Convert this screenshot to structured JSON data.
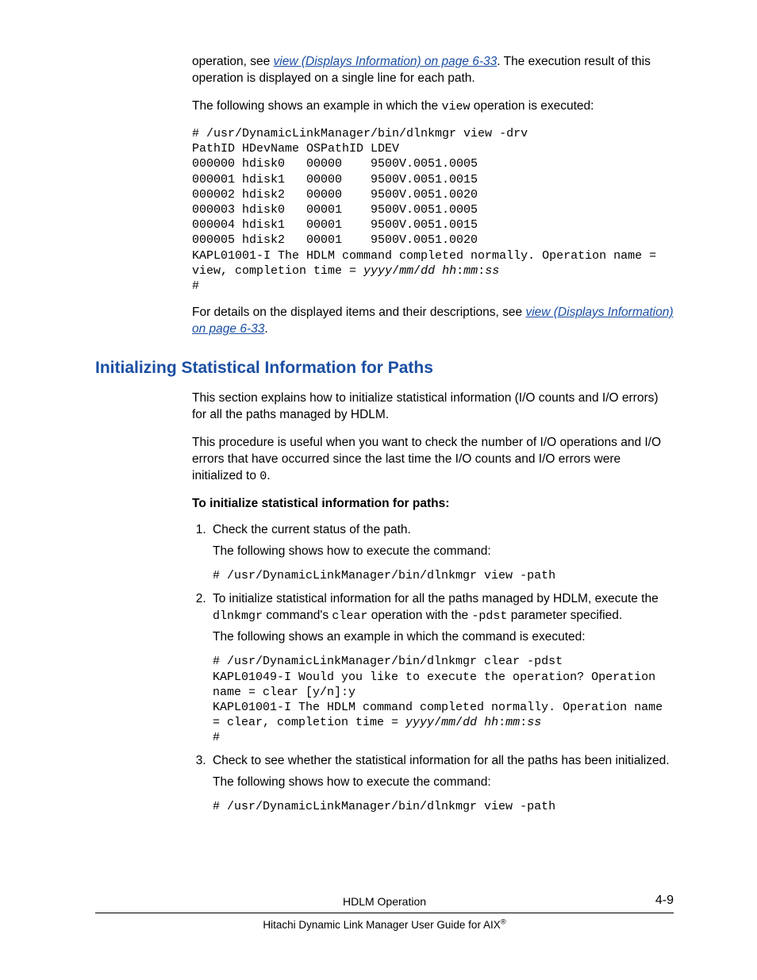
{
  "intro": {
    "p1_a": "operation, see ",
    "link1": "view (Displays Information) on page 6-33",
    "p1_b": ". The execution result of this operation is displayed on a single line for each path.",
    "p2_a": "The following shows an example in which the ",
    "p2_code": "view",
    "p2_b": " operation is executed:"
  },
  "code1": {
    "l1": "# /usr/DynamicLinkManager/bin/dlnkmgr view -drv",
    "l2": "PathID HDevName OSPathID LDEV",
    "l3": "000000 hdisk0   00000    9500V.0051.0005",
    "l4": "000001 hdisk1   00000    9500V.0051.0015",
    "l5": "000002 hdisk2   00000    9500V.0051.0020",
    "l6": "000003 hdisk0   00001    9500V.0051.0005",
    "l7": "000004 hdisk1   00001    9500V.0051.0015",
    "l8": "000005 hdisk2   00001    9500V.0051.0020",
    "l9": "KAPL01001-I The HDLM command completed normally. Operation name = ",
    "l10a": "view, completion time = ",
    "l10b_i": "yyyy",
    "l10c": "/",
    "l10d_i": "mm",
    "l10e": "/",
    "l10f_i": "dd",
    "l10g": " ",
    "l10h_i": "hh",
    "l10i": ":",
    "l10j_i": "mm",
    "l10k": ":",
    "l10l_i": "ss",
    "l11": "#"
  },
  "after_code1": {
    "a": "For details on the displayed items and their descriptions, see ",
    "link": "view (Displays Information) on page 6-33",
    "b": "."
  },
  "section_title": "Initializing Statistical Information for Paths",
  "sec": {
    "p1": "This section explains how to initialize statistical information (I/O counts and I/O errors) for all the paths managed by HDLM.",
    "p2a": "This procedure is useful when you want to check the number of I/O operations and I/O errors that have occurred since the last time the I/O counts and I/O errors were initialized to ",
    "p2code": "0",
    "p2b": ".",
    "bold": "To initialize statistical information for paths:"
  },
  "steps": {
    "s1": {
      "p1": "Check the current status of the path.",
      "p2": "The following shows how to execute the command:",
      "cmd": "# /usr/DynamicLinkManager/bin/dlnkmgr view -path"
    },
    "s2": {
      "p1a": "To initialize statistical information for all the paths managed by HDLM, execute the ",
      "p1code1": "dlnkmgr",
      "p1b": " command's ",
      "p1code2": "clear",
      "p1c": " operation with the ",
      "p1code3": "-pdst",
      "p1d": " parameter specified.",
      "p2": "The following shows an example in which the command is executed:",
      "c1": "# /usr/DynamicLinkManager/bin/dlnkmgr clear -pdst",
      "c2": "KAPL01049-I Would you like to execute the operation? Operation ",
      "c3": "name = clear [y/n]:y",
      "c4": "KAPL01001-I The HDLM command completed normally. Operation name ",
      "c5a": "= clear, completion time = ",
      "c5b_i": "yyyy",
      "c5c": "/",
      "c5d_i": "mm",
      "c5e": "/",
      "c5f_i": "dd",
      "c5g": " ",
      "c5h_i": "hh",
      "c5i": ":",
      "c5j_i": "mm",
      "c5k": ":",
      "c5l_i": "ss",
      "c6": "#"
    },
    "s3": {
      "p1": "Check to see whether the statistical information for all the paths has been initialized.",
      "p2": "The following shows how to execute the command:",
      "cmd": "# /usr/DynamicLinkManager/bin/dlnkmgr view -path"
    }
  },
  "footer": {
    "title": "HDLM Operation",
    "page": "4-9",
    "doc_a": "Hitachi Dynamic Link Manager User Guide for AIX",
    "doc_sup": "®"
  }
}
